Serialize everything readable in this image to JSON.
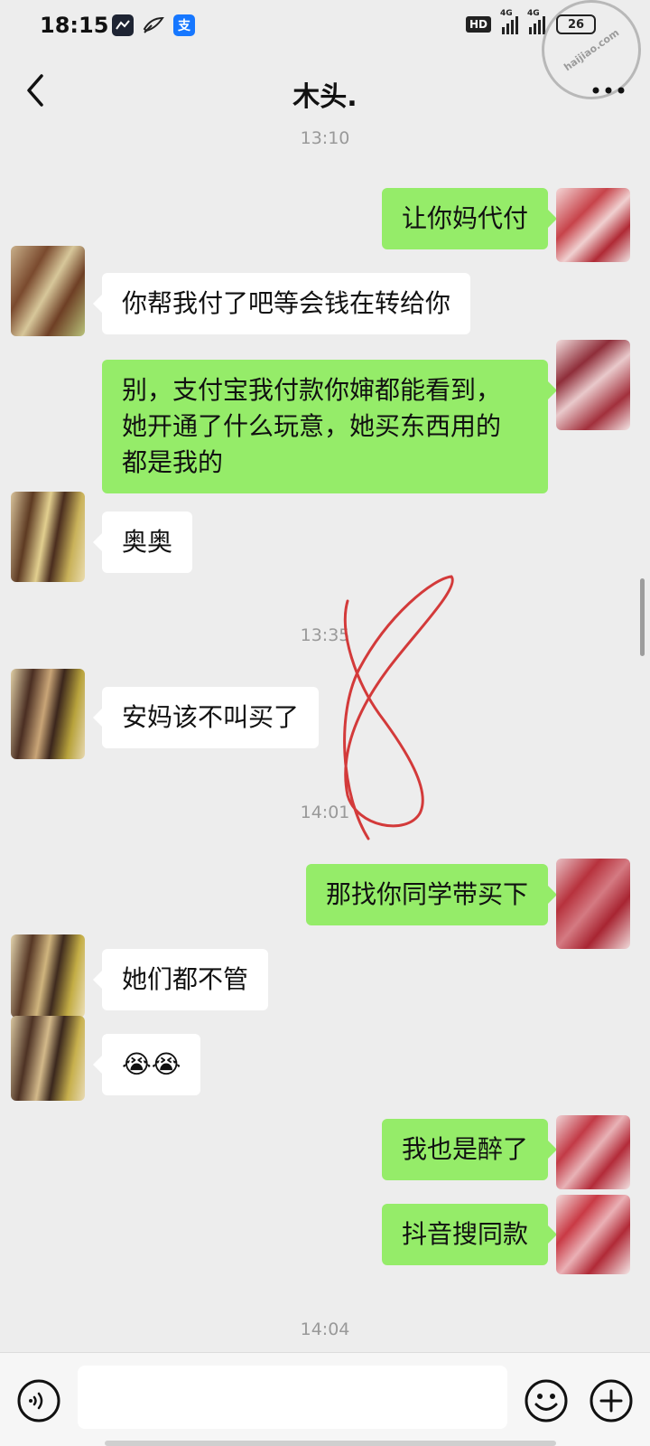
{
  "status_bar": {
    "time": "18:15",
    "hd_label": "HD",
    "network_1": "4G",
    "network_2": "4G",
    "battery": "26",
    "app_icon_alipay": "支"
  },
  "watermark": {
    "text": "haijiao.com"
  },
  "header": {
    "title": "木头."
  },
  "timestamps": [
    "13:10",
    "13:35",
    "14:01",
    "14:04"
  ],
  "messages": [
    {
      "side": "right",
      "text": "让你妈代付"
    },
    {
      "side": "left",
      "text": "你帮我付了吧等会钱在转给你"
    },
    {
      "side": "right",
      "lines": [
        "别，支付宝我付款你婶都能看到，",
        "她开通了什么玩意，她买东西用的",
        "都是我的"
      ]
    },
    {
      "side": "left",
      "text": "奥奥"
    },
    {
      "side": "left",
      "text": "安妈该不叫买了"
    },
    {
      "side": "right",
      "text": "那找你同学带买下"
    },
    {
      "side": "left",
      "text": "她们都不管"
    },
    {
      "side": "left",
      "text": "😭😭"
    },
    {
      "side": "right",
      "text": "我也是醉了"
    },
    {
      "side": "right",
      "text": "抖音搜同款"
    }
  ],
  "input": {
    "placeholder": ""
  },
  "colors": {
    "background": "#ededed",
    "sent_bubble": "#95ec69",
    "received_bubble": "#ffffff",
    "timestamp": "#999999",
    "annotation": "#d33a3a"
  }
}
